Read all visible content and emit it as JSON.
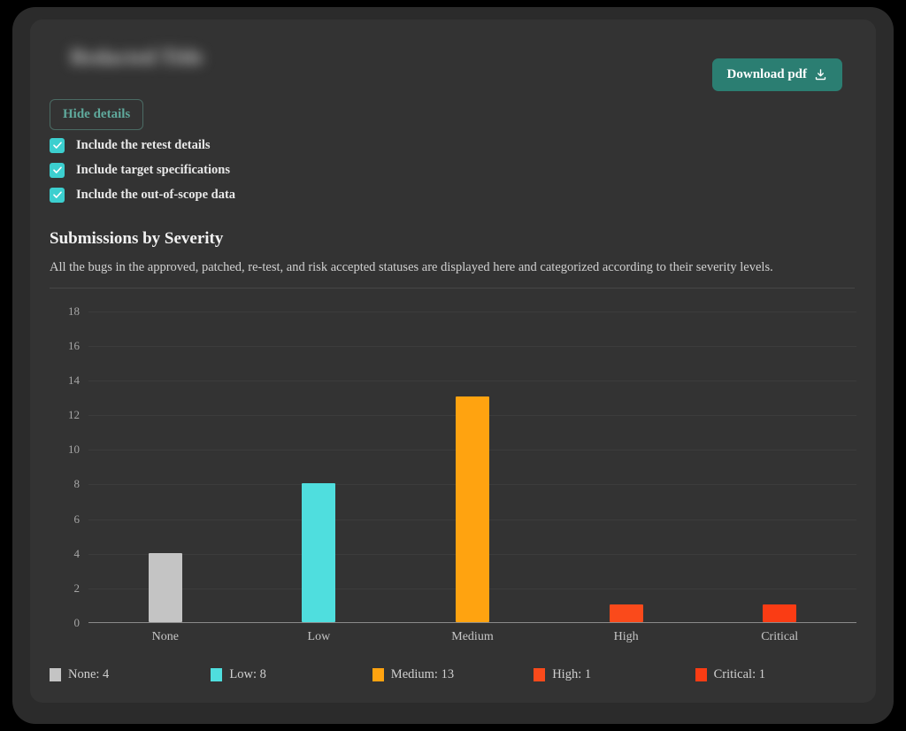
{
  "header": {
    "report_title": "Redacted  Title",
    "download_label": "Download pdf",
    "download_icon": "download-icon"
  },
  "controls": {
    "hide_details_label": "Hide details",
    "options": [
      {
        "label": "Include the retest details",
        "checked": true
      },
      {
        "label": "Include target specifications",
        "checked": true
      },
      {
        "label": "Include the out-of-scope data",
        "checked": true
      }
    ]
  },
  "section": {
    "title": "Submissions by Severity",
    "description": "All the bugs in the approved, patched, re-test, and risk accepted statuses are displayed here and categorized according to their severity levels."
  },
  "chart_data": {
    "type": "bar",
    "title": "Submissions by Severity",
    "xlabel": "",
    "ylabel": "",
    "categories": [
      "None",
      "Low",
      "Medium",
      "High",
      "Critical"
    ],
    "values": [
      4,
      8,
      13,
      1,
      1
    ],
    "colors": [
      "#c4c4c4",
      "#4fdede",
      "#ffa310",
      "#fa4a1b",
      "#fa3c14"
    ],
    "ylim": [
      0,
      19
    ],
    "yticks": [
      18,
      16,
      14,
      12,
      10,
      8,
      6,
      4,
      2,
      0
    ],
    "grid": true,
    "legend_position": "bottom",
    "legend": [
      {
        "label": "None: 4",
        "color": "#c4c4c4"
      },
      {
        "label": "Low: 8",
        "color": "#4fdede"
      },
      {
        "label": "Medium: 13",
        "color": "#ffa310"
      },
      {
        "label": "High: 1",
        "color": "#fa4a1b"
      },
      {
        "label": "Critical: 1",
        "color": "#fa3c14"
      }
    ]
  },
  "theme": {
    "page_background": "#000000",
    "shell_background": "#2b2b2b",
    "panel_background": "#333333",
    "accent_teal": "#2b7e72",
    "checkbox_teal": "#3ccfcf",
    "outline_teal": "#5fa99c"
  }
}
